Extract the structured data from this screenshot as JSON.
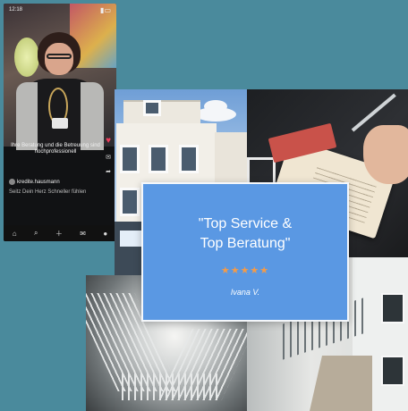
{
  "review": {
    "quote_line1": "\"Top Service &",
    "quote_line2": "Top Beratung\"",
    "stars": "★★★★★",
    "author": "Ivana V."
  },
  "phone": {
    "status_time": "12:18",
    "caption": "Ihre Beratung und die Betreuung sind hochprofessionell",
    "account": "kredite.hausmann",
    "description": "Seitz Dein Herz Schneller fühlen",
    "tabs": [
      "⌂",
      "⌕",
      "＋",
      "✉",
      "●"
    ]
  },
  "colors": {
    "background": "#4a8a9c",
    "card": "#5a98e3",
    "stars": "#f29b4a"
  }
}
